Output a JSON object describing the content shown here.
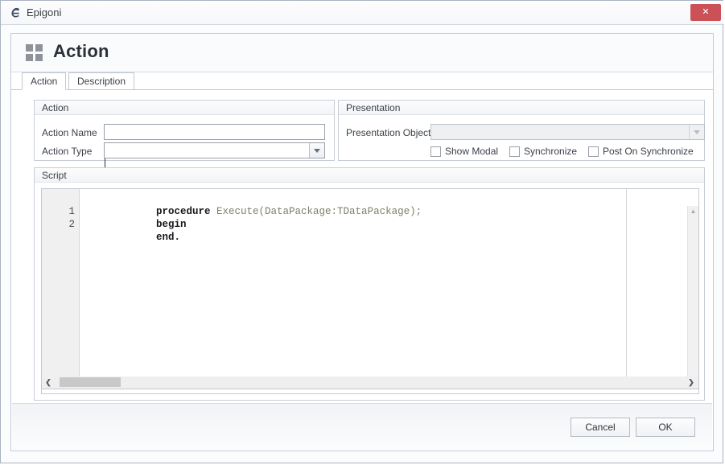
{
  "window": {
    "title": "Epigoni",
    "icon": "epigoni-logo-icon",
    "close_label": "✕"
  },
  "dialog": {
    "header_icon": "grid-2x2-icon",
    "title": "Action",
    "tabs": [
      {
        "label": "Action",
        "active": true
      },
      {
        "label": "Description",
        "active": false
      }
    ]
  },
  "action_group": {
    "title": "Action",
    "fields": [
      {
        "label": "Action Name",
        "value": "",
        "placeholder": ""
      },
      {
        "label": "Action Type",
        "value": "",
        "placeholder": ""
      }
    ]
  },
  "presentation_group": {
    "title": "Presentation",
    "object_label": "Presentation Object",
    "object_value": "",
    "checkboxes": [
      {
        "label": "Show Modal",
        "checked": false
      },
      {
        "label": "Synchronize",
        "checked": false
      },
      {
        "label": "Post On Synchronize",
        "checked": false
      }
    ]
  },
  "script_group": {
    "title": "Script",
    "lines": [
      {
        "number": "",
        "keyword": "procedure ",
        "rest": "Execute(DataPackage:TDataPackage);"
      },
      {
        "number": "1",
        "keyword": "begin",
        "rest": ""
      },
      {
        "number": "2",
        "keyword": "end.",
        "rest": ""
      }
    ],
    "scroll_up_glyph": "▲",
    "scroll_left_glyph": "❮",
    "scroll_right_glyph": "❯"
  },
  "footer": {
    "cancel_label": "Cancel",
    "ok_label": "OK"
  },
  "colors": {
    "close_red": "#cb5157",
    "keyword": "#17181c",
    "identifier": "#7c7f68",
    "border": "#c8ced7"
  }
}
